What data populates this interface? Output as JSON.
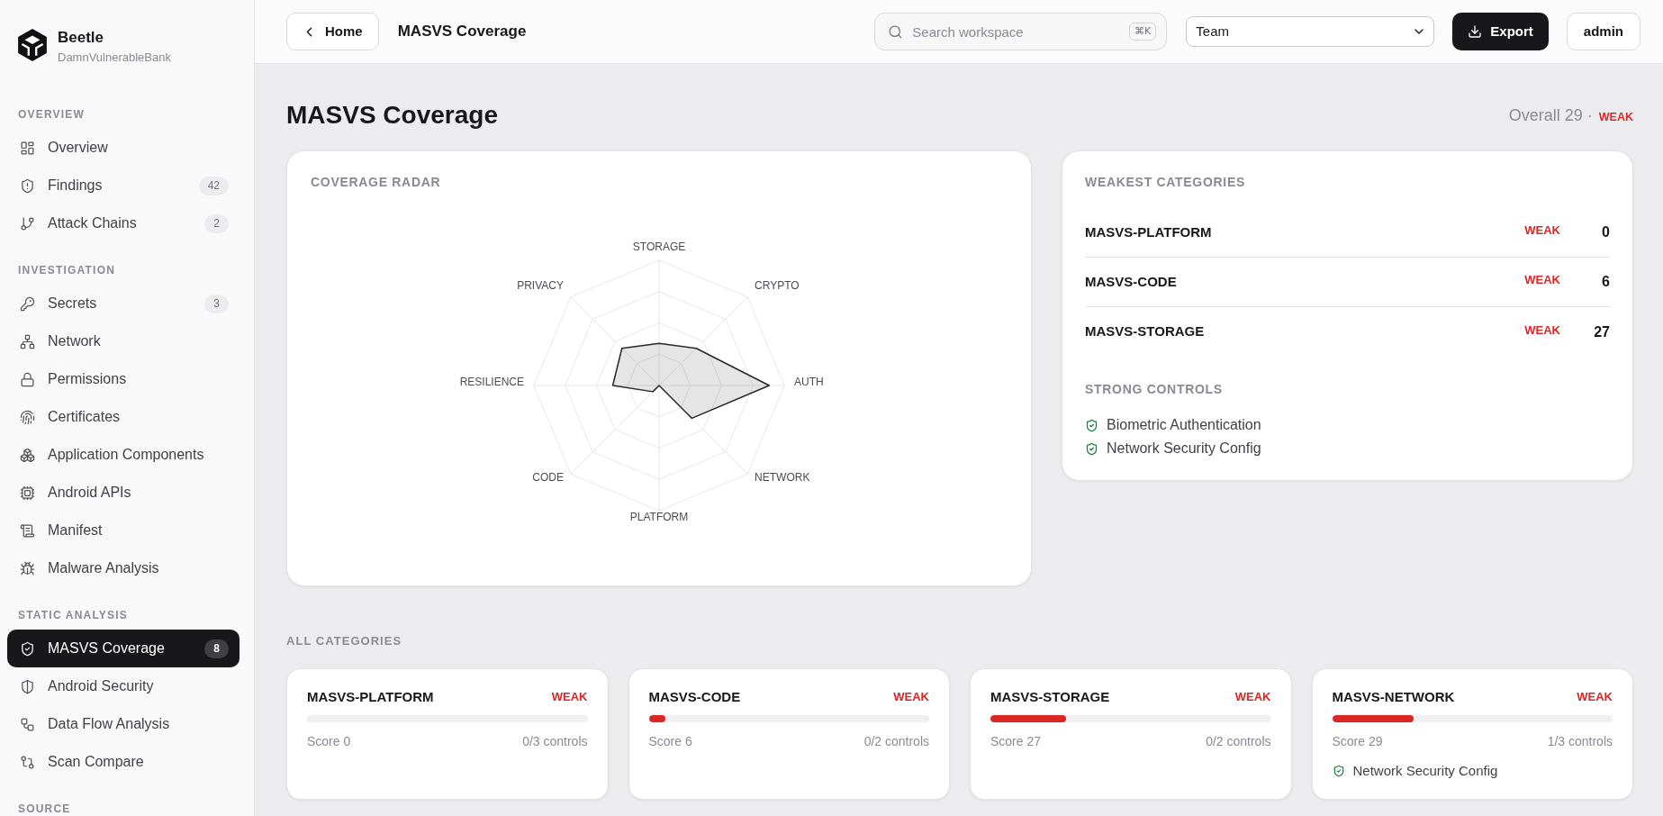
{
  "sidebar": {
    "brand": {
      "name": "Beetle",
      "subtitle": "DamnVulnerableBank"
    },
    "sections": [
      {
        "title": "OVERVIEW",
        "items": [
          {
            "label": "Overview",
            "selected": false
          },
          {
            "label": "Findings",
            "badge": "42",
            "selected": false
          },
          {
            "label": "Attack Chains",
            "badge": "2",
            "selected": false
          }
        ]
      },
      {
        "title": "INVESTIGATION",
        "items": [
          {
            "label": "Secrets",
            "badge": "3",
            "selected": false
          },
          {
            "label": "Network",
            "selected": false
          },
          {
            "label": "Permissions",
            "selected": false
          },
          {
            "label": "Certificates",
            "selected": false
          },
          {
            "label": "Application Components",
            "selected": false
          },
          {
            "label": "Android APIs",
            "selected": false
          },
          {
            "label": "Manifest",
            "selected": false
          },
          {
            "label": "Malware Analysis",
            "selected": false
          }
        ]
      },
      {
        "title": "STATIC ANALYSIS",
        "items": [
          {
            "label": "MASVS Coverage",
            "badge": "8",
            "selected": true
          },
          {
            "label": "Android Security",
            "selected": false
          },
          {
            "label": "Data Flow Analysis",
            "selected": false
          },
          {
            "label": "Scan Compare",
            "selected": false
          }
        ]
      },
      {
        "title": "SOURCE"
      }
    ]
  },
  "topbar": {
    "back_button": "Home",
    "page_title": "MASVS Coverage",
    "search": {
      "placeholder": "Search workspace",
      "shortcut": "⌘K"
    },
    "scope_select": {
      "value": "Team"
    },
    "export_button": "Export",
    "user_button": "admin"
  },
  "header": {
    "title": "MASVS Coverage",
    "overall": "Overall 29 ·",
    "overall_status": "WEAK"
  },
  "radar": {
    "title": "COVERAGE RADAR",
    "axes": [
      "STORAGE",
      "CRYPTO",
      "AUTH",
      "NETWORK",
      "PLATFORM",
      "CODE",
      "RESILIENCE",
      "PRIVACY"
    ]
  },
  "weakest": {
    "title": "WEAKEST CATEGORIES",
    "rows": [
      {
        "name": "MASVS-PLATFORM",
        "status": "WEAK",
        "score": "0"
      },
      {
        "name": "MASVS-CODE",
        "status": "WEAK",
        "score": "6"
      },
      {
        "name": "MASVS-STORAGE",
        "status": "WEAK",
        "score": "27"
      }
    ],
    "strong_title": "STRONG CONTROLS",
    "strong_controls": [
      "Biometric Authentication",
      "Network Security Config"
    ]
  },
  "all_categories": {
    "title": "ALL CATEGORIES",
    "cards": [
      {
        "name": "MASVS-PLATFORM",
        "status": "WEAK",
        "score": "Score 0",
        "controls": "0/3 controls"
      },
      {
        "name": "MASVS-CODE",
        "status": "WEAK",
        "level": 0.06,
        "score": "Score 6",
        "controls": "0/2 controls"
      },
      {
        "name": "MASVS-STORAGE",
        "status": "WEAK",
        "level": 0.27,
        "score": "Score 27",
        "controls": "0/2 controls"
      },
      {
        "name": "MASVS-NETWORK",
        "status": "WEAK",
        "level": 0.29,
        "score": "Score 29",
        "controls": "1/3 controls",
        "strong_controls": [
          "Network Security Config"
        ]
      }
    ]
  }
}
